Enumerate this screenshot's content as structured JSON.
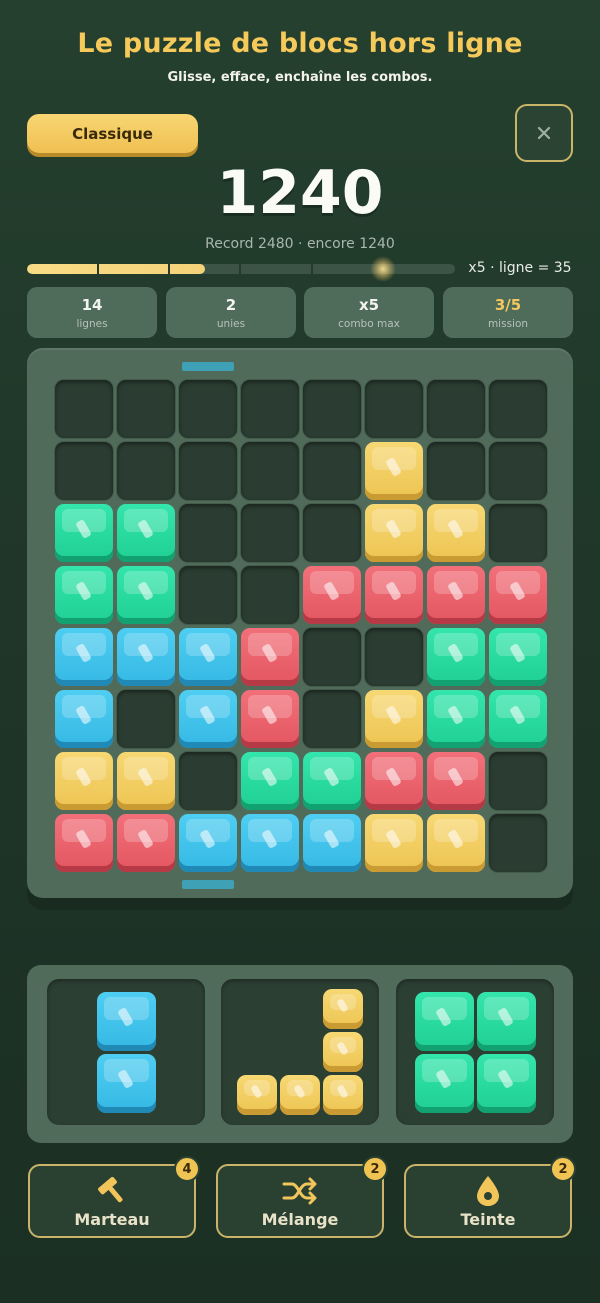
{
  "header": {
    "title": "Le puzzle de blocs hors ligne",
    "subtitle": "Glisse, efface, enchaîne les combos."
  },
  "mode_button": {
    "label": "Classique"
  },
  "close_button": {
    "icon": "close-icon",
    "glyph": "×"
  },
  "score": {
    "value": "1240",
    "record_text": "Record 2480 · encore 1240",
    "progress_fraction": 0.5,
    "multiplier_text": "x5 · ligne = 35"
  },
  "stats": [
    {
      "value": "14",
      "label": "lignes"
    },
    {
      "value": "2",
      "label": "unies"
    },
    {
      "value": "x5",
      "label": "combo max"
    },
    {
      "value": "3/5",
      "label": "mission"
    }
  ],
  "board": {
    "rows": 8,
    "cols": 8,
    "marker_column": 2,
    "cells": [
      [
        "",
        "",
        "",
        "",
        "",
        "",
        "",
        ""
      ],
      [
        "",
        "",
        "",
        "",
        "",
        "yellow",
        "",
        ""
      ],
      [
        "green",
        "green",
        "",
        "",
        "",
        "yellow",
        "yellow",
        ""
      ],
      [
        "green",
        "green",
        "",
        "",
        "red",
        "red",
        "red",
        "red"
      ],
      [
        "blue",
        "blue",
        "blue",
        "red",
        "",
        "",
        "green",
        "green"
      ],
      [
        "blue",
        "",
        "blue",
        "red",
        "",
        "yellow",
        "green",
        "green"
      ],
      [
        "yellow",
        "yellow",
        "",
        "green",
        "green",
        "red",
        "red",
        ""
      ],
      [
        "red",
        "red",
        "blue",
        "blue",
        "blue",
        "yellow",
        "yellow",
        ""
      ]
    ]
  },
  "tray": {
    "pieces": [
      {
        "color": "blue",
        "cells": [
          [
            0,
            0
          ],
          [
            1,
            0
          ]
        ]
      },
      {
        "color": "yellow",
        "cells": [
          [
            0,
            2
          ],
          [
            1,
            2
          ],
          [
            2,
            0
          ],
          [
            2,
            1
          ],
          [
            2,
            2
          ]
        ]
      },
      {
        "color": "green",
        "cells": [
          [
            0,
            0
          ],
          [
            0,
            1
          ],
          [
            1,
            0
          ],
          [
            1,
            1
          ]
        ]
      }
    ]
  },
  "powerups": [
    {
      "label": "Marteau",
      "count": "4",
      "icon": "hammer-icon"
    },
    {
      "label": "Mélange",
      "count": "2",
      "icon": "shuffle-icon"
    },
    {
      "label": "Teinte",
      "count": "2",
      "icon": "drop-icon"
    }
  ],
  "colors": {
    "yellow": "#f0c653",
    "green": "#25d99b",
    "red": "#e85e68",
    "blue": "#3bbfea",
    "accent_gold": "#f5c95a"
  }
}
